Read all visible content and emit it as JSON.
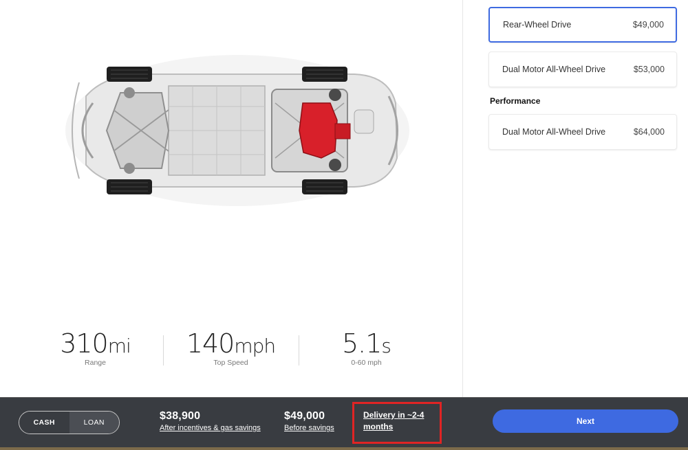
{
  "stats": [
    {
      "value": "310",
      "unit": "mi",
      "label": "Range"
    },
    {
      "value": "140",
      "unit": "mph",
      "label": "Top Speed"
    },
    {
      "value": "5.1",
      "unit": "s",
      "label": "0-60 mph"
    }
  ],
  "options": {
    "rwd": {
      "name": "Rear-Wheel Drive",
      "price": "$49,000"
    },
    "awd": {
      "name": "Dual Motor All-Wheel Drive",
      "price": "$53,000"
    },
    "performance_label": "Performance",
    "perf": {
      "name": "Dual Motor All-Wheel Drive",
      "price": "$64,000"
    }
  },
  "footer": {
    "cash": "CASH",
    "loan": "LOAN",
    "price_after": "$38,900",
    "price_after_sub": "After incentives & gas savings",
    "price_before": "$49,000",
    "price_before_sub": "Before savings",
    "delivery": "Delivery in ~2-4 months",
    "next": "Next"
  },
  "colors": {
    "accent": "#3e6ae1",
    "footer_bg": "#393c41",
    "highlight": "#e02424",
    "motor": "#d8202a"
  }
}
